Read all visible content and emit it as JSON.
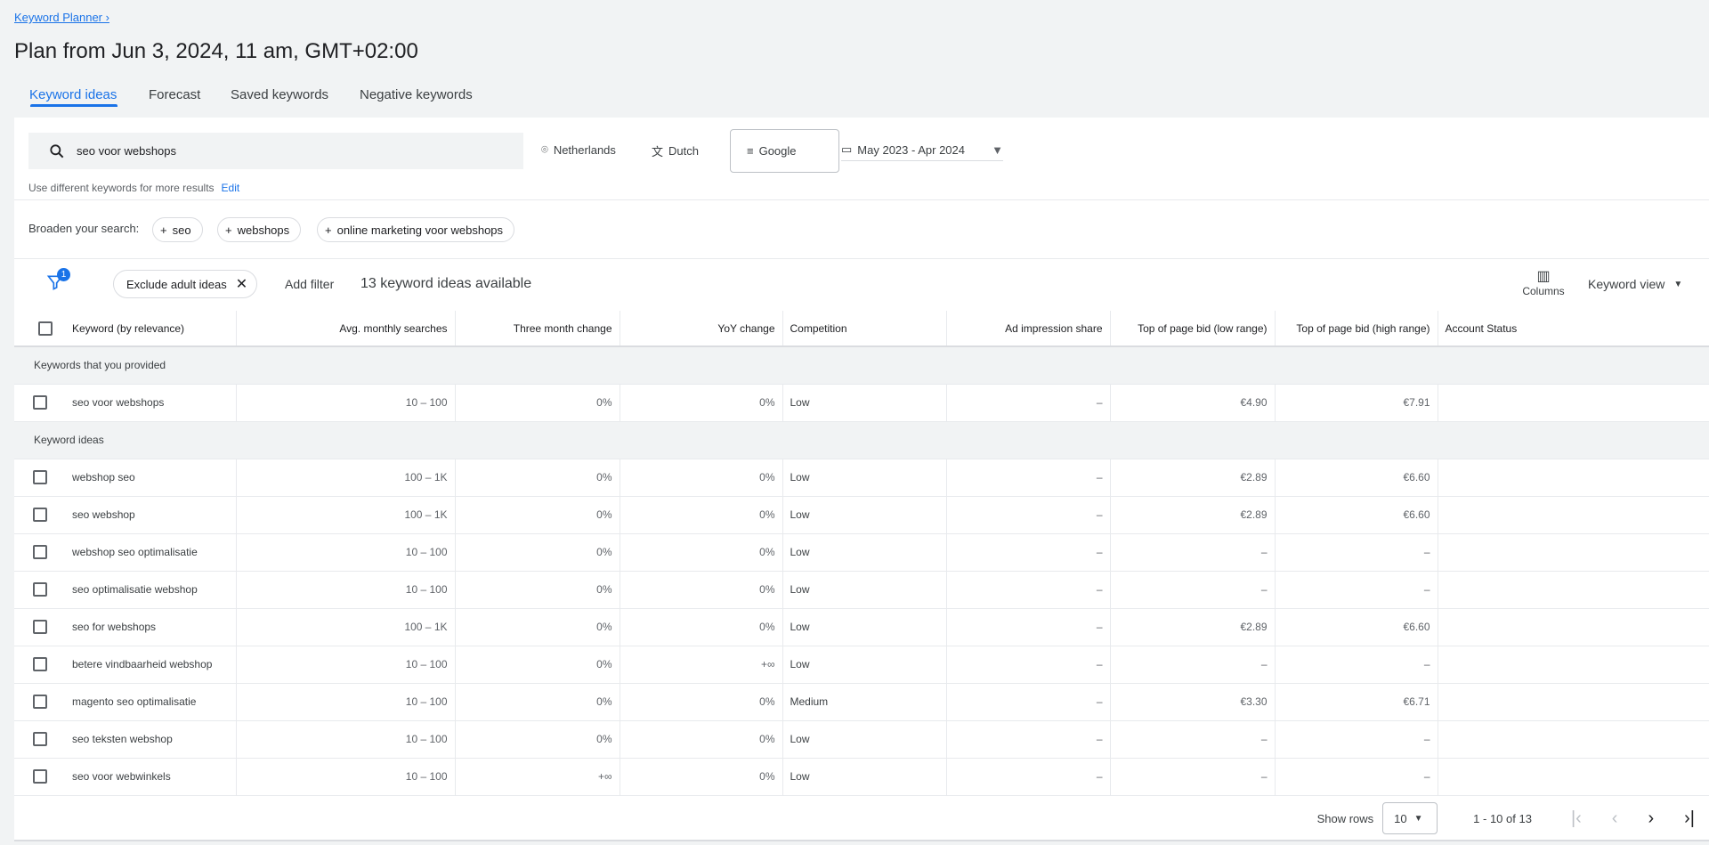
{
  "breadcrumb": "Keyword Planner",
  "title": "Plan from Jun 3, 2024, 11 am, GMT+02:00",
  "tabs": [
    "Keyword ideas",
    "Forecast",
    "Saved keywords",
    "Negative keywords"
  ],
  "search": {
    "value": "seo voor webshops",
    "location": "Netherlands",
    "language": "Dutch",
    "network": "Google",
    "date_range": "May 2023 - Apr 2024",
    "hint": "Use different keywords for more results",
    "edit": "Edit"
  },
  "broaden": {
    "label": "Broaden your search:",
    "chips": [
      "seo",
      "webshops",
      "online marketing voor webshops"
    ]
  },
  "toolbar": {
    "filter_count": "1",
    "exclude_chip": "Exclude adult ideas",
    "add_filter": "Add filter",
    "count": "13 keyword ideas available",
    "columns": "Columns",
    "view": "Keyword view"
  },
  "table": {
    "headers": [
      "Keyword (by relevance)",
      "Avg. monthly searches",
      "Three month change",
      "YoY change",
      "Competition",
      "Ad impression share",
      "Top of page bid (low range)",
      "Top of page bid (high range)",
      "Account Status"
    ],
    "group1": "Keywords that you provided",
    "provided": [
      [
        "seo voor webshops",
        "10 – 100",
        "0%",
        "0%",
        "Low",
        "–",
        "€4.90",
        "€7.91",
        ""
      ]
    ],
    "group2": "Keyword ideas",
    "ideas": [
      [
        "webshop seo",
        "100 – 1K",
        "0%",
        "0%",
        "Low",
        "–",
        "€2.89",
        "€6.60",
        ""
      ],
      [
        "seo webshop",
        "100 – 1K",
        "0%",
        "0%",
        "Low",
        "–",
        "€2.89",
        "€6.60",
        ""
      ],
      [
        "webshop seo optimalisatie",
        "10 – 100",
        "0%",
        "0%",
        "Low",
        "–",
        "–",
        "–",
        ""
      ],
      [
        "seo optimalisatie webshop",
        "10 – 100",
        "0%",
        "0%",
        "Low",
        "–",
        "–",
        "–",
        ""
      ],
      [
        "seo for webshops",
        "100 – 1K",
        "0%",
        "0%",
        "Low",
        "–",
        "€2.89",
        "€6.60",
        ""
      ],
      [
        "betere vindbaarheid webshop",
        "10 – 100",
        "0%",
        "+∞",
        "Low",
        "–",
        "–",
        "–",
        ""
      ],
      [
        "magento seo optimalisatie",
        "10 – 100",
        "0%",
        "0%",
        "Medium",
        "–",
        "€3.30",
        "€6.71",
        ""
      ],
      [
        "seo teksten webshop",
        "10 – 100",
        "0%",
        "0%",
        "Low",
        "–",
        "–",
        "–",
        ""
      ],
      [
        "seo voor webwinkels",
        "10 – 100",
        "+∞",
        "0%",
        "Low",
        "–",
        "–",
        "–",
        ""
      ]
    ]
  },
  "footer": {
    "show_rows": "Show rows",
    "rows_value": "10",
    "range": "1 - 10 of 13"
  },
  "colors": {
    "accent": "#1a73e8",
    "background": "#f1f3f4"
  }
}
